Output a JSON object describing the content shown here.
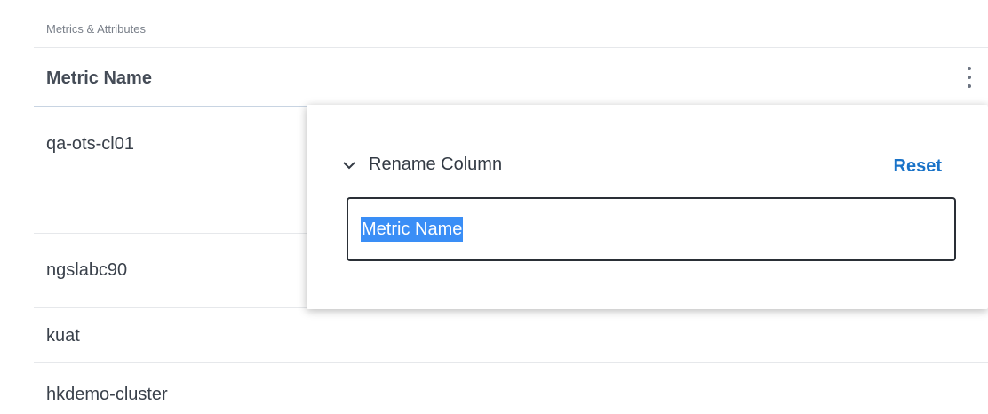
{
  "section": {
    "title": "Metrics & Attributes"
  },
  "table": {
    "column_header": "Metric Name",
    "menu_icon": "more-vertical-icon",
    "rows": [
      "qa-ots-cl01",
      "ngslabc90",
      "kuat",
      "hkdemo-cluster"
    ]
  },
  "popover": {
    "toggle_icon": "chevron-down-icon",
    "rename_label": "Rename Column",
    "reset_label": "Reset",
    "input_value": "Metric Name"
  },
  "colors": {
    "accent": "#1a73c8",
    "selection": "#3a8ef6"
  }
}
